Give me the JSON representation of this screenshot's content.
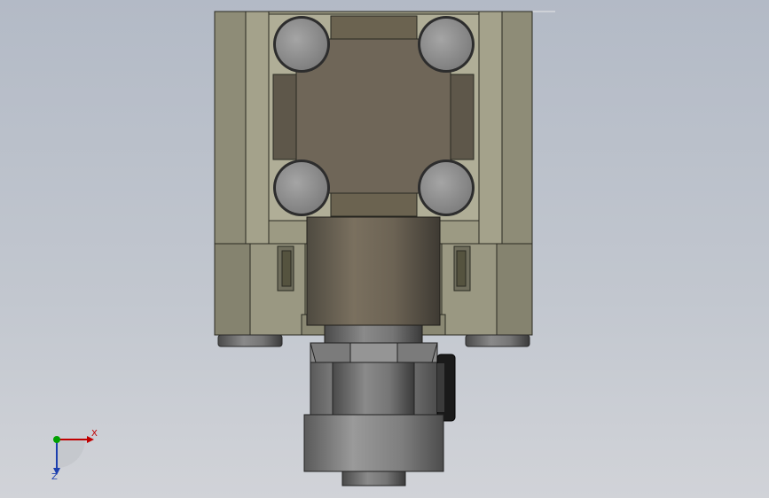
{
  "colors": {
    "background_top": "#b3bac6",
    "background_bottom": "#d1d3d8",
    "body_light": "#9c9a83",
    "body_mid": "#8b8a74",
    "body_dark": "#6d6b5b",
    "plate": "#857b6c",
    "bolt": "#8c8c8c",
    "cylinder": "#6f6658",
    "bottom_assembly": "#6e6e6e",
    "axis_x": "#c00000",
    "axis_y": "#00a000",
    "axis_z": "#1c3fae"
  },
  "triad": {
    "x_label": "X",
    "z_label": "Z"
  }
}
